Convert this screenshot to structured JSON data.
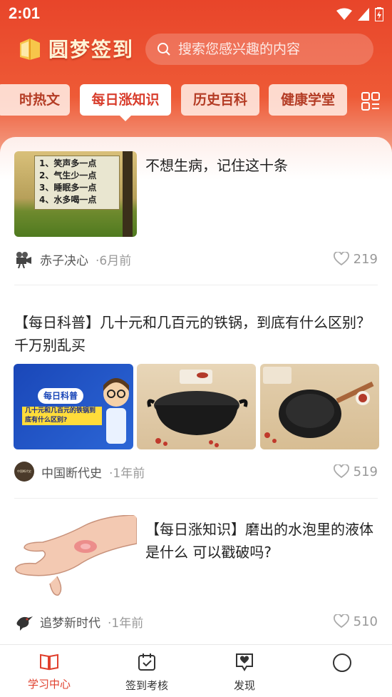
{
  "status": {
    "time": "2:01"
  },
  "header": {
    "app_title": "圆梦签到",
    "search_placeholder": "搜索您感兴趣的内容"
  },
  "tabs": [
    {
      "label": "时热文"
    },
    {
      "label": "每日涨知识",
      "active": true
    },
    {
      "label": "历史百科"
    },
    {
      "label": "健康学堂"
    }
  ],
  "articles": [
    {
      "title": "不想生病，记住这十条",
      "thumb_lines": [
        "1、笑声多一点",
        "2、气生少一点",
        "3、睡眠多一点",
        "4、水多喝一点"
      ],
      "author": "赤子决心",
      "ago": "·6月前",
      "likes": "219"
    },
    {
      "title": "【每日科普】几十元和几百元的铁锅，到底有什么区别？千万别乱买",
      "thumb_badge": "每日科普",
      "thumb_text": "几十元和几百元的铁锅到底有什么区别?",
      "author": "中国断代史",
      "avatar_text": "中国断代史",
      "ago": "·1年前",
      "likes": "519"
    },
    {
      "title": "【每日涨知识】磨出的水泡里的液体是什么 可以戳破吗?",
      "author": "追梦新时代",
      "ago": "·1年前",
      "likes": "510"
    }
  ],
  "bottom_nav": [
    {
      "label": "学习中心",
      "icon": "book-icon",
      "active": true
    },
    {
      "label": "签到考核",
      "icon": "calendar-check-icon"
    },
    {
      "label": "发现",
      "icon": "heart-chat-icon"
    },
    {
      "label": "",
      "icon": "profile-circle-icon"
    }
  ],
  "colors": {
    "accent": "#e0402d",
    "hero_top": "#e8452a",
    "tab_text": "#b43c25"
  }
}
